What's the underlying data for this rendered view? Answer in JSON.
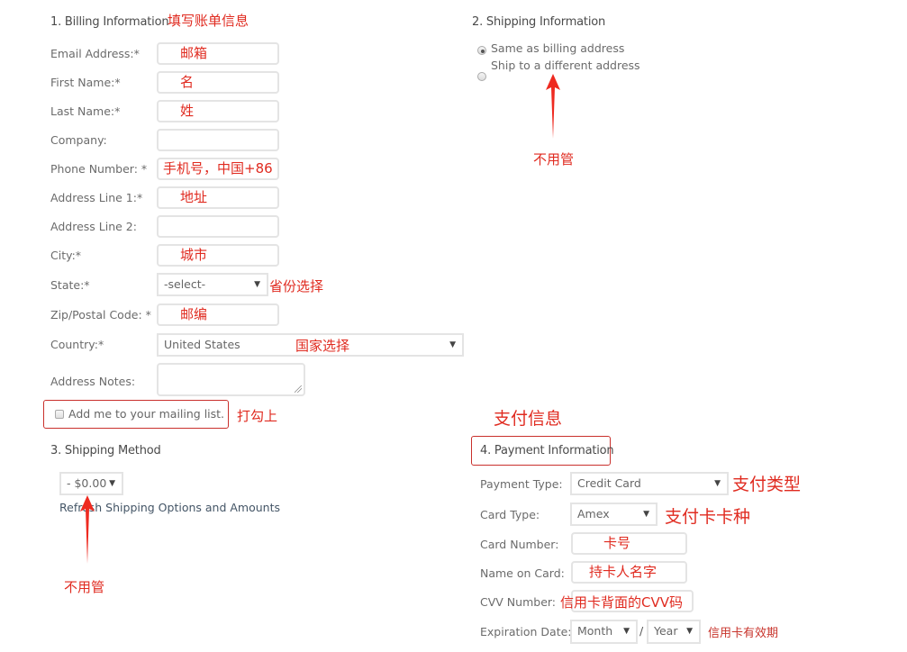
{
  "billing": {
    "heading": "1. Billing Information",
    "heading_note": "填写账单信息",
    "fields": [
      {
        "label": "Email Address:*",
        "value": "邮箱"
      },
      {
        "label": "First Name:*",
        "value": "名"
      },
      {
        "label": "Last Name:*",
        "value": "姓"
      },
      {
        "label": "Company:",
        "value": ""
      },
      {
        "label": "Phone Number: *",
        "value": "手机号，中国+86"
      },
      {
        "label": "Address Line 1:*",
        "value": "地址"
      },
      {
        "label": "Address Line 2:",
        "value": ""
      },
      {
        "label": "City:*",
        "value": "城市"
      }
    ],
    "state": {
      "label": "State:*",
      "selected": "-select-",
      "note": "省份选择"
    },
    "zip": {
      "label": "Zip/Postal Code: *",
      "value": "邮编"
    },
    "country": {
      "label": "Country:*",
      "selected": "United States",
      "note": "国家选择"
    },
    "notes": {
      "label": "Address Notes:",
      "value": ""
    },
    "mailing_list": {
      "label": "Add me to your mailing list.",
      "checked": false,
      "note": "打勾上"
    }
  },
  "shipping_info": {
    "heading": "2. Shipping Information",
    "options": [
      {
        "label": "Same as billing address",
        "selected": true
      },
      {
        "label": "Ship to a different address",
        "selected": false
      }
    ],
    "note": "不用管"
  },
  "shipping_method": {
    "heading": "3. Shipping Method",
    "selected": "- $0.00",
    "refresh_link": "Refresh Shipping Options and Amounts",
    "note": "不用管"
  },
  "payment": {
    "section_note": "支付信息",
    "heading": "4. Payment Information",
    "payment_type": {
      "label": "Payment Type:",
      "selected": "Credit Card",
      "note": "支付类型"
    },
    "card_type": {
      "label": "Card Type:",
      "selected": "Amex",
      "note": "支付卡卡种"
    },
    "card_number": {
      "label": "Card Number:",
      "value": "卡号"
    },
    "name_on_card": {
      "label": "Name on Card:",
      "value": "持卡人名字"
    },
    "cvv": {
      "label": "CVV Number:",
      "value": "信用卡背面的CVV码"
    },
    "expiration": {
      "label": "Expiration Date:",
      "month": "Month",
      "separator": "/",
      "year": "Year",
      "note": "信用卡有效期"
    }
  },
  "icons": {
    "dropdown": "▼"
  }
}
